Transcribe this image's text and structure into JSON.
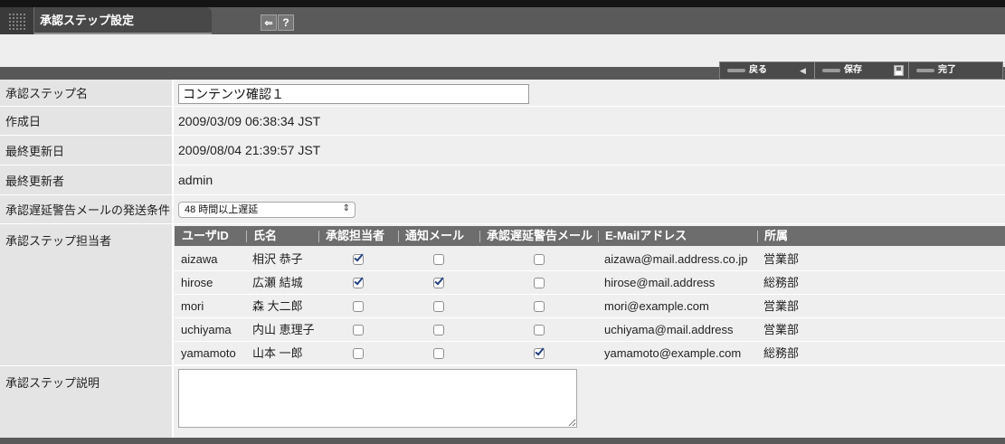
{
  "header": {
    "title": "承認ステップ設定",
    "menu_icon": "grid-icon",
    "back_icon": "back-icon",
    "help_icon": "help-icon"
  },
  "toolbar": {
    "back_label": "戻る",
    "back_icon": "back-arrow-icon",
    "save_label": "保存",
    "save_icon": "save-icon",
    "done_label": "完了"
  },
  "form": {
    "step_name": {
      "label": "承認ステップ名",
      "value": "コンテンツ確認１"
    },
    "created": {
      "label": "作成日",
      "value": "2009/03/09 06:38:34 JST"
    },
    "updated": {
      "label": "最終更新日",
      "value": "2009/08/04 21:39:57 JST"
    },
    "updated_by": {
      "label": "最終更新者",
      "value": "admin"
    },
    "delay_condition": {
      "label": "承認遅延警告メールの発送条件",
      "selected": "48 時間以上遅延"
    },
    "assignees": {
      "label": "承認ステップ担当者",
      "columns": [
        "ユーザID",
        "氏名",
        "承認担当者",
        "通知メール",
        "承認遅延警告メール",
        "E-Mailアドレス",
        "所属"
      ],
      "rows": [
        {
          "user_id": "aizawa",
          "name": "相沢 恭子",
          "approver": true,
          "notify": false,
          "delay_warning": false,
          "email": "aizawa@mail.address.co.jp",
          "department": "営業部"
        },
        {
          "user_id": "hirose",
          "name": "広瀬 結城",
          "approver": true,
          "notify": true,
          "delay_warning": false,
          "email": "hirose@mail.address",
          "department": "総務部"
        },
        {
          "user_id": "mori",
          "name": "森 大二郎",
          "approver": false,
          "notify": false,
          "delay_warning": false,
          "email": "mori@example.com",
          "department": "営業部"
        },
        {
          "user_id": "uchiyama",
          "name": "内山 恵理子",
          "approver": false,
          "notify": false,
          "delay_warning": false,
          "email": "uchiyama@mail.address",
          "department": "営業部"
        },
        {
          "user_id": "yamamoto",
          "name": "山本 一郎",
          "approver": false,
          "notify": false,
          "delay_warning": true,
          "email": "yamamoto@example.com",
          "department": "総務部"
        }
      ]
    },
    "description": {
      "label": "承認ステップ説明",
      "value": ""
    }
  },
  "colors": {
    "header_bg": "#5a5a5a",
    "toolbar_bg": "#585858",
    "label_bg": "#e4e4e4",
    "value_bg": "#efefef",
    "table_header_bg": "#6d6d6d",
    "check_color": "#20407f"
  }
}
